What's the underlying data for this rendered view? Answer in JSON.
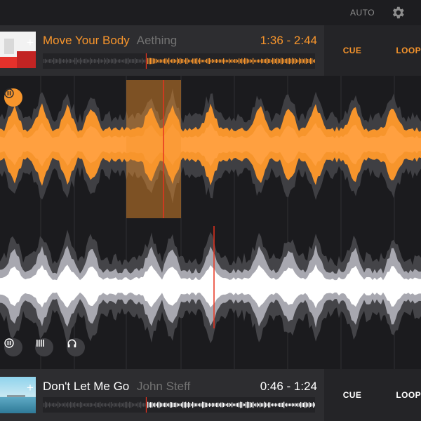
{
  "topbar": {
    "auto_label": "AUTO",
    "settings_icon": "gear-icon"
  },
  "deck_a": {
    "title": "Move Your Body",
    "artist": "Aething",
    "time": "1:36 - 2:44",
    "cue_label": "CUE",
    "loop_label": "LOOP",
    "progress": 0.38,
    "accent_color": "#f7952c"
  },
  "deck_b": {
    "title": "Don't Let Me Go",
    "artist": "John Steff",
    "time": "0:46 - 1:24",
    "cue_label": "CUE",
    "loop_label": "LOOP",
    "progress": 0.38,
    "accent_color": "#ffffff"
  },
  "colors": {
    "deck_a_wave": "#f7952c",
    "deck_b_wave": "#ffffff",
    "playhead": "#e8321f",
    "background": "#1b1b1e"
  },
  "icons": {
    "deck_a_pause": "pause-icon",
    "deck_b_pause": "pause-icon",
    "beatgrid": "beatgrid-icon",
    "headphones": "headphones-icon"
  }
}
